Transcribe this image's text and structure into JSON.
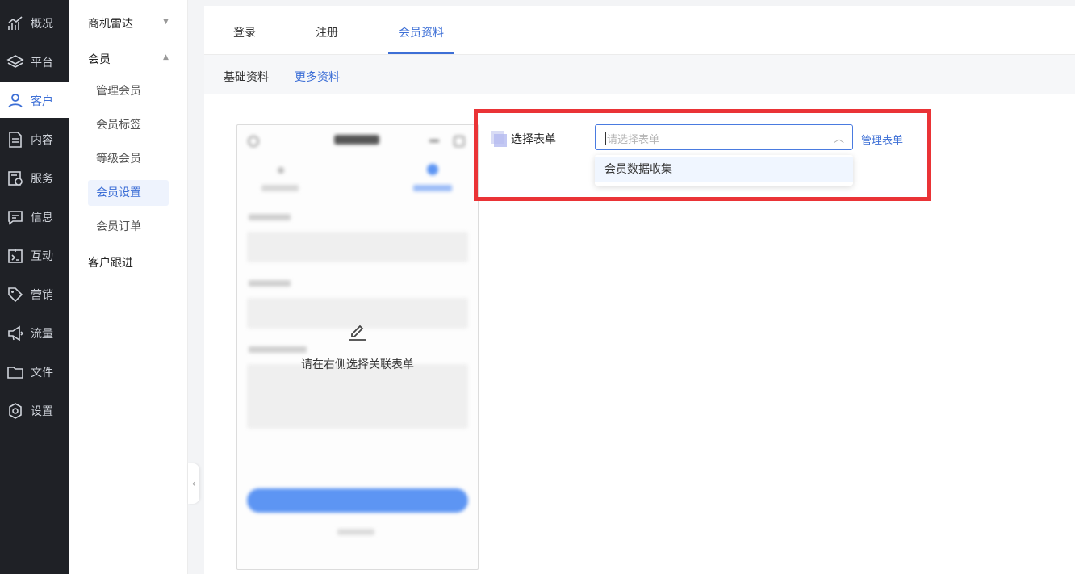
{
  "nav": {
    "items": [
      {
        "label": "概况",
        "icon": "chart-icon"
      },
      {
        "label": "平台",
        "icon": "layers-icon"
      },
      {
        "label": "客户",
        "icon": "user-icon",
        "active": true
      },
      {
        "label": "内容",
        "icon": "document-icon"
      },
      {
        "label": "服务",
        "icon": "service-icon"
      },
      {
        "label": "信息",
        "icon": "message-icon"
      },
      {
        "label": "互动",
        "icon": "interact-icon"
      },
      {
        "label": "营销",
        "icon": "tag-icon"
      },
      {
        "label": "流量",
        "icon": "megaphone-icon"
      },
      {
        "label": "文件",
        "icon": "folder-icon"
      },
      {
        "label": "设置",
        "icon": "settings-icon"
      }
    ]
  },
  "submenu": {
    "group1": "商机雷达",
    "group2": "会员",
    "items": [
      "管理会员",
      "会员标签",
      "等级会员",
      "会员设置",
      "会员订单"
    ],
    "group3": "客户跟进"
  },
  "tabs": [
    "登录",
    "注册",
    "会员资料"
  ],
  "subtabs": [
    "基础资料",
    "更多资料"
  ],
  "preview": {
    "hint": "请在右侧选择关联表单"
  },
  "form": {
    "label": "选择表单",
    "placeholder": "请选择表单",
    "option": "会员数据收集",
    "manage_link": "管理表单"
  },
  "colors": {
    "accent": "#3d6fd6",
    "nav_bg": "#1f2126",
    "highlight": "#ea3336"
  }
}
